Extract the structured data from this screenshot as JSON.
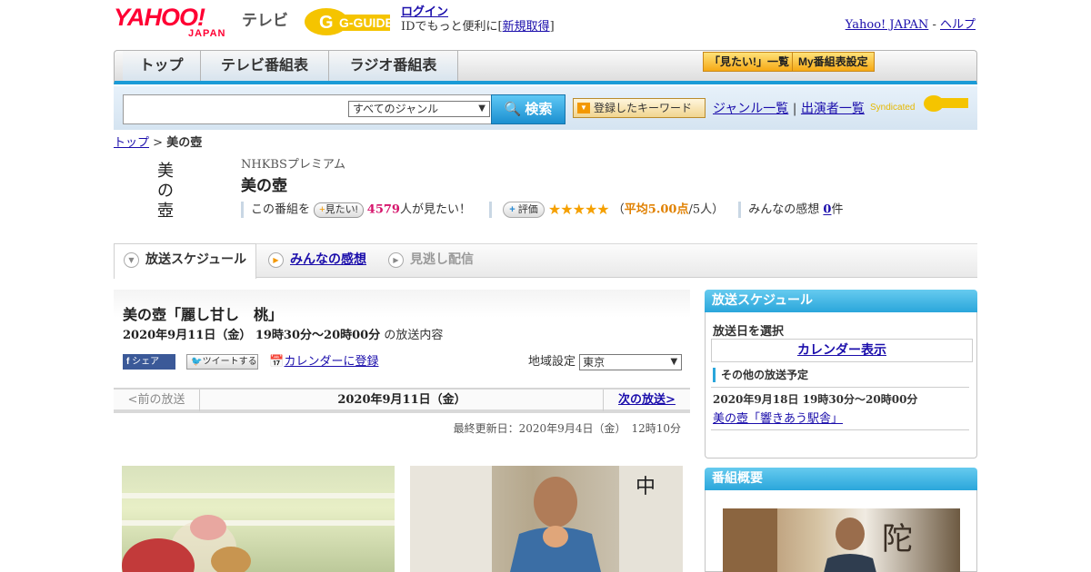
{
  "header": {
    "yahoo_logo": "YAHOO!",
    "yahoo_sub": "JAPAN",
    "tv_label": "テレビ",
    "gguide_logo": "G-GUIDE",
    "login": "ログイン",
    "login_sub_prefix": "IDでもっと便利に[",
    "signup": "新規取得",
    "login_sub_suffix": "]",
    "yahoo_japan": "Yahoo! JAPAN",
    "help_sep": "-",
    "help": "ヘルプ"
  },
  "nav": {
    "tabs": [
      "トップ",
      "テレビ番組表",
      "ラジオ番組表"
    ],
    "mitai_list": "「見たい!」一覧",
    "my_table": "My番組表設定"
  },
  "search": {
    "genre": "すべてのジャンル",
    "search_button": "検索",
    "keyword_button": "登録したキーワード",
    "genre_list": "ジャンル一覧",
    "divider": "|",
    "performer_list": "出演者一覧",
    "syndicated": "Syndicated"
  },
  "breadcrumb": {
    "top": "トップ",
    "sep": ">",
    "current": "美の壺"
  },
  "program": {
    "logo_text": "美の壺",
    "channel": "NHKBSプレミアム",
    "title": "美の壺",
    "mitai_prefix": "この番組を",
    "mitai_button": "見たい!",
    "mitai_count": "4579",
    "mitai_suffix": "人が見たい！",
    "hyoka_button": "評価",
    "stars": "★★★★★",
    "avg_open": "（",
    "avg_label": "平均5.00点",
    "avg_tail": "/5人）",
    "kansou_label": "みんなの感想",
    "kansou_count": "0",
    "kansou_suffix": "件"
  },
  "tabs": {
    "schedule": "放送スケジュール",
    "kansou": "みんなの感想",
    "minogashi": "見逃し配信"
  },
  "episode": {
    "title": "美の壺「麗し甘し　桃」",
    "time": "2020年9月11日（金）  19時30分～20時00分",
    "time_suffix": "の放送内容",
    "facebook": "シェア",
    "twitter": "ツイートする",
    "calendar": "カレンダーに登録",
    "region_label": "地域設定",
    "region": "東京"
  },
  "date_nav": {
    "prev": "<前の放送",
    "current": "2020年9月11日（金）",
    "next": "次の放送>"
  },
  "updated": "最終更新日：2020年9月4日（金）　12時10分",
  "sidebar": {
    "schedule_head": "放送スケジュール",
    "select_date": "放送日を選択",
    "calendar": "カレンダー表示",
    "other_label": "その他の放送予定",
    "other_date": "2020年9月18日  19時30分～20時00分",
    "other_link": "美の壺「響きあう駅舎」",
    "summary_head": "番組概要"
  },
  "colors": {
    "accent_blue": "#1a9bd7",
    "pink": "#d6156c",
    "star": "#f5a000",
    "yahoo_red": "#ff0033"
  }
}
